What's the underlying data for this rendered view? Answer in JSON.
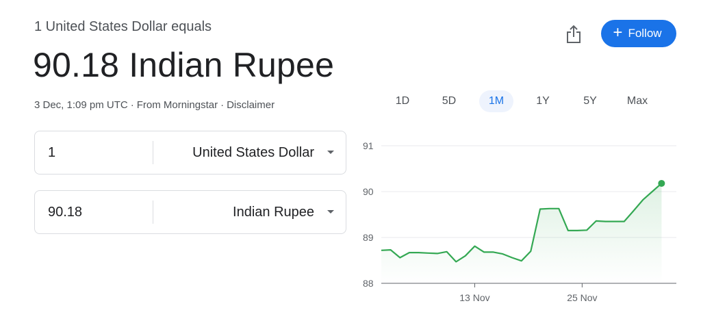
{
  "header": {
    "subtitle": "1 United States Dollar equals",
    "rate_text": "90.18 Indian Rupee",
    "meta": {
      "timestamp": "3 Dec, 1:09 pm UTC",
      "separator": "·",
      "source": "From Morningstar",
      "disclaimer": "Disclaimer"
    }
  },
  "actions": {
    "share_icon": "share-icon",
    "follow_label": "Follow",
    "follow_icon": "plus-icon",
    "follow_color": "#1a73e8"
  },
  "converter": {
    "from": {
      "amount": "1",
      "currency": "United States Dollar"
    },
    "to": {
      "amount": "90.18",
      "currency": "Indian Rupee"
    }
  },
  "range_tabs": [
    {
      "label": "1D",
      "active": false
    },
    {
      "label": "5D",
      "active": false
    },
    {
      "label": "1M",
      "active": true
    },
    {
      "label": "1Y",
      "active": false
    },
    {
      "label": "5Y",
      "active": false
    },
    {
      "label": "Max",
      "active": false
    }
  ],
  "chart_data": {
    "type": "area",
    "line_color": "#34a853",
    "y_ticks": [
      "91",
      "90",
      "89",
      "88"
    ],
    "ylim": [
      88,
      91
    ],
    "xlim": [
      0,
      31
    ],
    "x_ticks": [
      {
        "label": "13 Nov",
        "x": 10
      },
      {
        "label": "25 Nov",
        "x": 21.5
      }
    ],
    "series": [
      {
        "x": [
          0,
          1,
          2,
          3,
          4,
          5,
          6,
          7,
          8,
          9,
          10,
          11,
          12,
          13,
          14,
          15,
          16,
          17,
          18,
          19,
          20,
          21,
          22,
          23,
          24,
          25,
          26,
          27,
          28,
          29,
          30
        ],
        "y": [
          88.72,
          88.73,
          88.56,
          88.67,
          88.67,
          88.66,
          88.65,
          88.69,
          88.47,
          88.6,
          88.81,
          88.68,
          88.68,
          88.64,
          88.56,
          88.49,
          88.7,
          89.62,
          89.63,
          89.63,
          89.15,
          89.15,
          89.16,
          89.36,
          89.35,
          89.35,
          89.35,
          89.58,
          89.82,
          90.0,
          90.18
        ]
      }
    ],
    "grid": true
  }
}
